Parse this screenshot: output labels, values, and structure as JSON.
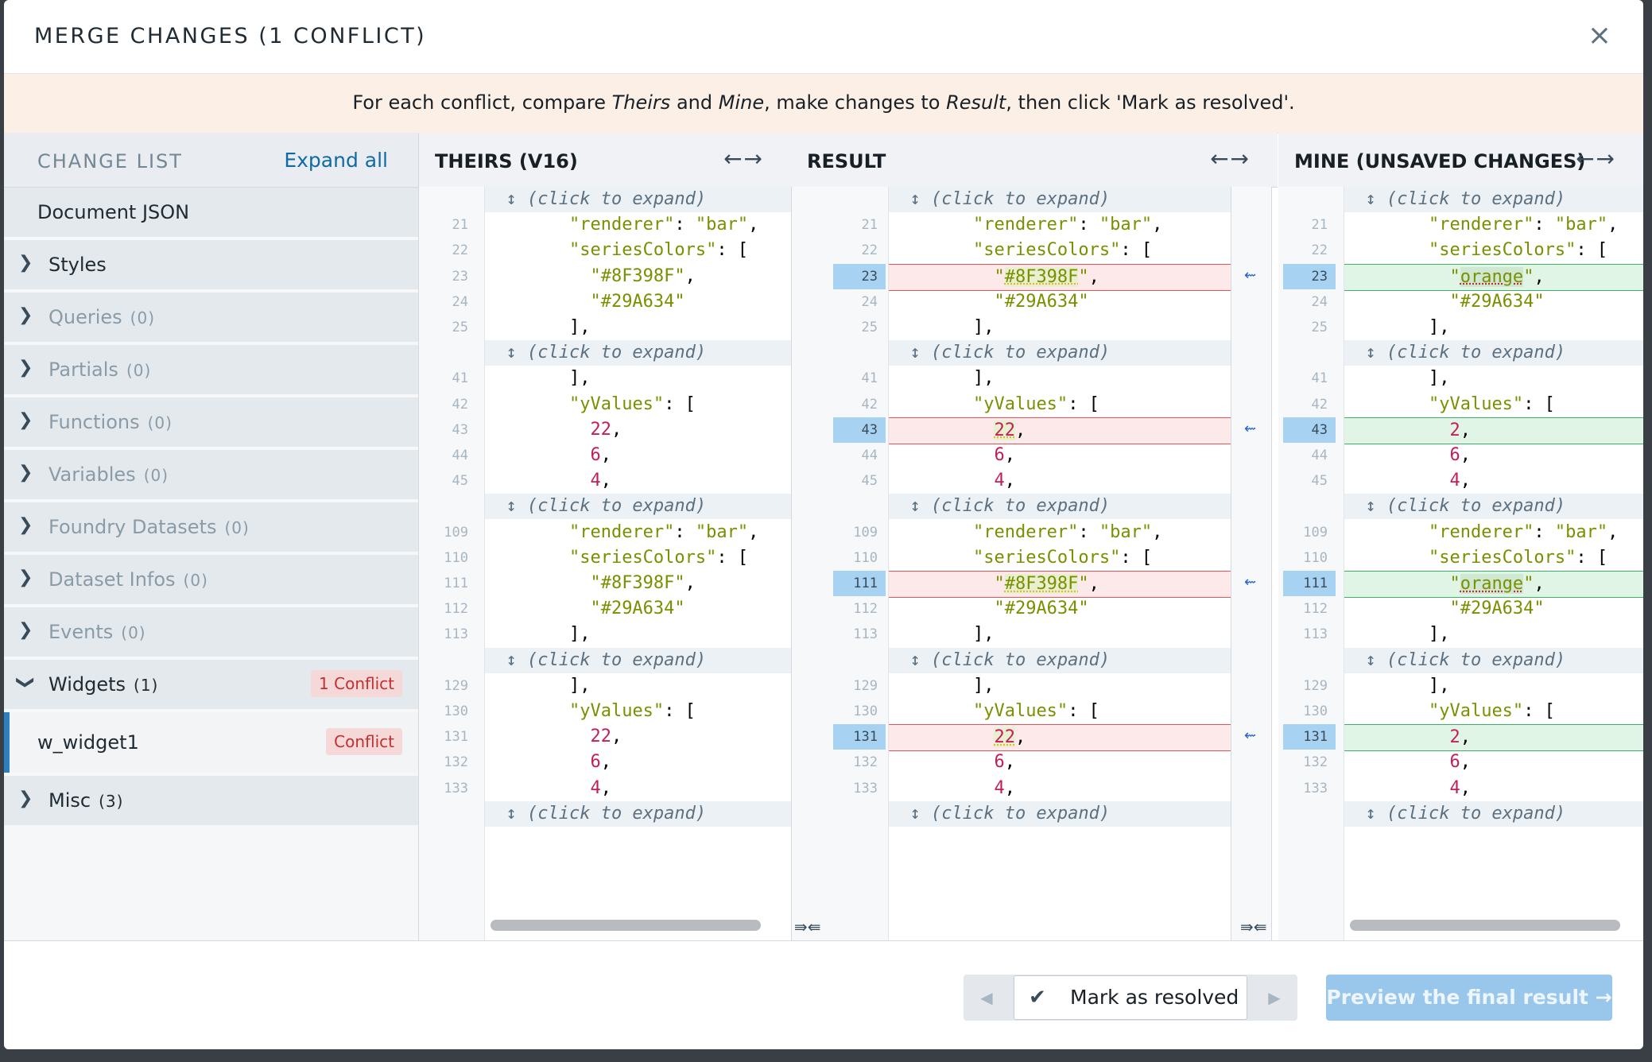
{
  "dialog": {
    "title": "MERGE CHANGES (1 CONFLICT)",
    "close_icon": "×",
    "banner": {
      "pre": "For each conflict, compare ",
      "theirs": "Theirs",
      "and": " and ",
      "mine": "Mine",
      "mid": ", make changes to ",
      "result": "Result",
      "post": ", then click 'Mark as resolved'."
    }
  },
  "sidebar": {
    "title": "CHANGE LIST",
    "expand_all": "Expand all",
    "root": "Document JSON",
    "items": [
      {
        "label": "Styles",
        "count": ""
      },
      {
        "label": "Queries",
        "count": "(0)"
      },
      {
        "label": "Partials",
        "count": "(0)"
      },
      {
        "label": "Functions",
        "count": "(0)"
      },
      {
        "label": "Variables",
        "count": "(0)"
      },
      {
        "label": "Foundry Datasets",
        "count": "(0)"
      },
      {
        "label": "Dataset Infos",
        "count": "(0)"
      },
      {
        "label": "Events",
        "count": "(0)"
      },
      {
        "label": "Widgets",
        "count": "(1)",
        "badge": "1 Conflict"
      },
      {
        "label": "Misc",
        "count": "(3)"
      }
    ],
    "selected": {
      "label": "w_widget1",
      "badge": "Conflict"
    }
  },
  "panes": {
    "theirs": {
      "title": "THEIRS (V16)",
      "arrows": "←→"
    },
    "result": {
      "title": "RESULT",
      "arrows": "←→"
    },
    "mine": {
      "title": "MINE (UNSAVED CHANGES)",
      "arrows": "←→"
    }
  },
  "code": {
    "expand_text": "↕ (click to expand)",
    "line_numbers": [
      "21",
      "22",
      "23",
      "24",
      "25",
      "41",
      "42",
      "43",
      "44",
      "45",
      "109",
      "110",
      "111",
      "112",
      "113",
      "129",
      "130",
      "131",
      "132",
      "133"
    ],
    "theirs_lines": [
      "        \"renderer\": \"bar\",",
      "        \"seriesColors\": [",
      "          \"#8F398F\",",
      "          \"#29A634\"",
      "        ],",
      "        ],",
      "        \"yValues\": [",
      "          22,",
      "          6,",
      "          4,"
    ],
    "mine_values": {
      "color": "\"orange\"",
      "number": "2"
    },
    "result_values": {
      "color": "\"#8F398F\"",
      "number": "22"
    }
  },
  "footer": {
    "mark_resolved": "Mark as resolved",
    "preview": "Preview the final result →",
    "prev_icon": "◀",
    "next_icon": "▶"
  }
}
